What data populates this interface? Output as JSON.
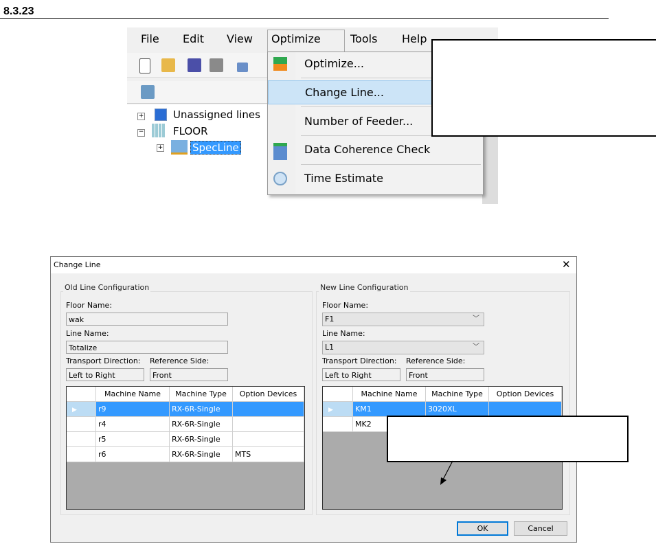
{
  "section": {
    "number": "8.3.23"
  },
  "menu_screenshot": {
    "menubar": [
      "File",
      "Edit",
      "View",
      "Optimize",
      "Tools",
      "Help"
    ],
    "tree": [
      {
        "label": "Unassigned lines",
        "icon": "unassigned-lines-icon"
      },
      {
        "label": "FLOOR",
        "icon": "floor-icon"
      },
      {
        "label": "SpecLine",
        "icon": "line-icon",
        "selected": true
      }
    ],
    "optimize_menu": [
      {
        "label": "Optimize...",
        "icon": "optimize-icon"
      },
      {
        "label": "Change Line...",
        "highlighted": true
      },
      {
        "label": "Number of Feeder..."
      },
      {
        "label": "Data Coherence Check",
        "icon": "data-check-icon"
      },
      {
        "label": "Time Estimate",
        "icon": "clock-icon"
      }
    ]
  },
  "dialog": {
    "title": "Change Line",
    "close": "✕",
    "old": {
      "group_label": "Old Line Configuration",
      "floor_label": "Floor Name:",
      "floor_value": "wak",
      "line_label": "Line Name:",
      "line_value": "Totalize",
      "transport_label": "Transport Direction:",
      "transport_value": "Left to Right",
      "ref_label": "Reference Side:",
      "ref_value": "Front",
      "columns": [
        "Machine Name",
        "Machine Type",
        "Option Devices"
      ],
      "rows": [
        {
          "name": "r9",
          "type": "RX-6R-Single",
          "options": ""
        },
        {
          "name": "r4",
          "type": "RX-6R-Single",
          "options": ""
        },
        {
          "name": "r5",
          "type": "RX-6R-Single",
          "options": ""
        },
        {
          "name": "r6",
          "type": "RX-6R-Single",
          "options": "MTS"
        }
      ]
    },
    "new": {
      "group_label": "New Line Configuration",
      "floor_label": "Floor Name:",
      "floor_value": "F1",
      "line_label": "Line Name:",
      "line_value": "L1",
      "transport_label": "Transport Direction:",
      "transport_value": "Left to Right",
      "ref_label": "Reference Side:",
      "ref_value": "Front",
      "columns": [
        "Machine Name",
        "Machine Type",
        "Option Devices"
      ],
      "rows": [
        {
          "name": "KM1",
          "type": "3020XL",
          "options": ""
        },
        {
          "name": "MK2",
          "type": "",
          "options": ""
        }
      ]
    },
    "ok": "OK",
    "cancel": "Cancel"
  },
  "colors": {
    "selection": "#3399ff",
    "menu_highlight": "#cce4f7",
    "grid_bg": "#ababab"
  }
}
